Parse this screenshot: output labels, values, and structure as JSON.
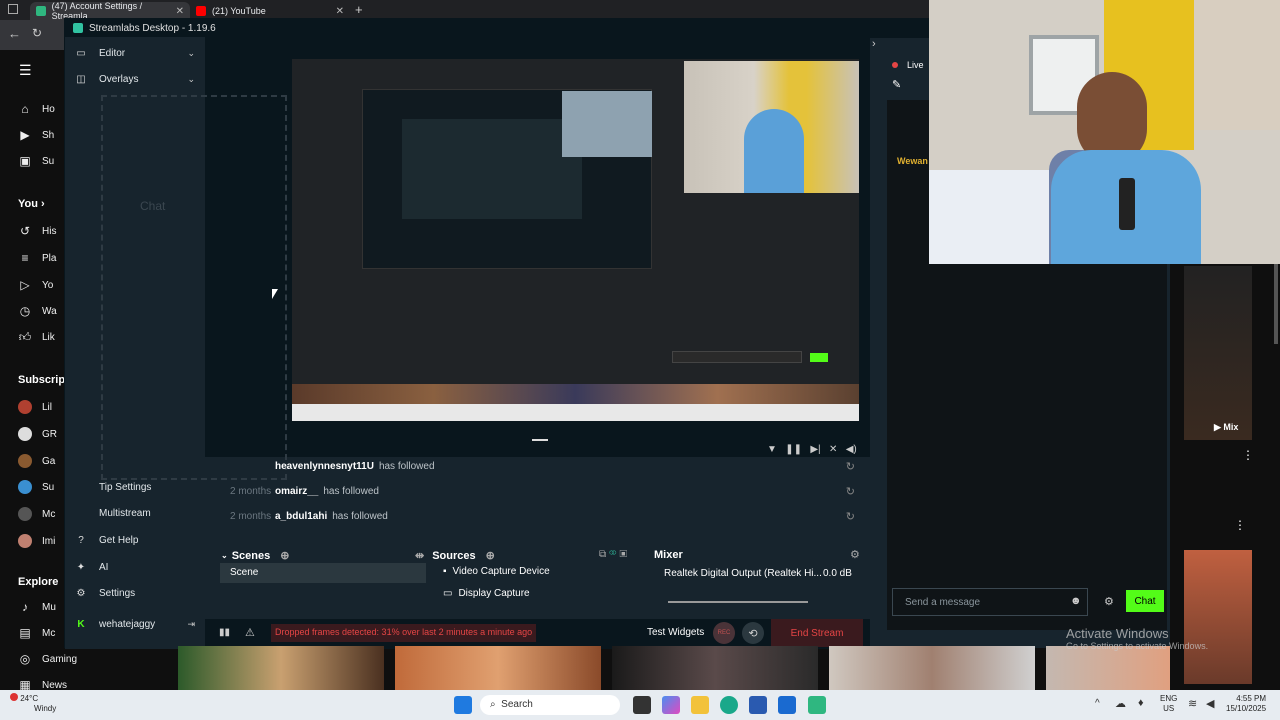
{
  "browser": {
    "tabs": [
      {
        "label": "(47) Account Settings / Streamla",
        "color": "#2fb780"
      },
      {
        "label": "(21) YouTube",
        "color": "#ff0000"
      }
    ]
  },
  "youtube": {
    "nav": [
      {
        "label": "Ho",
        "icon": "home-icon"
      },
      {
        "label": "Sh",
        "icon": "shorts-icon"
      },
      {
        "label": "Su",
        "icon": "subscriptions-icon"
      }
    ],
    "you_heading": "You",
    "you_items": [
      {
        "label": "His",
        "icon": "history-icon"
      },
      {
        "label": "Pla",
        "icon": "playlists-icon"
      },
      {
        "label": "Yo",
        "icon": "your-videos-icon"
      },
      {
        "label": "Wa",
        "icon": "watch-later-icon"
      },
      {
        "label": "Lik",
        "icon": "liked-icon"
      }
    ],
    "subscriptions_heading": "Subscript",
    "subscriptions": [
      {
        "label": "Lil",
        "color": "#b04030"
      },
      {
        "label": "GR",
        "color": "#dddddd"
      },
      {
        "label": "Ga",
        "color": "#8a5a30"
      },
      {
        "label": "Su",
        "color": "#3a8fd0"
      },
      {
        "label": "Mc",
        "color": "#555555"
      },
      {
        "label": "Imi",
        "color": "#c08070"
      }
    ],
    "explore_heading": "Explore",
    "explore": [
      {
        "label": "Mu",
        "icon": "music-icon"
      },
      {
        "label": "Mc",
        "icon": "movies-icon"
      },
      {
        "label": "Gaming",
        "icon": "gaming-icon"
      },
      {
        "label": "News",
        "icon": "news-icon"
      }
    ]
  },
  "streamlabs": {
    "title": "Streamlabs Desktop - 1.19.6",
    "nav": {
      "editor": "Editor",
      "overlays": "Overlays",
      "tip_settings": "Tip Settings",
      "multistream": "Multistream",
      "get_help": "Get Help",
      "ai": "AI",
      "settings": "Settings",
      "username": "wehatejaggy"
    },
    "chat_placeholder": "Chat",
    "feed": [
      {
        "time": "",
        "user": "heavenlynnesnyt11U",
        "action": "has followed"
      },
      {
        "time": "2 months",
        "user": "omairz__",
        "action": "has followed"
      },
      {
        "time": "2 months",
        "user": "a_bdul1ahi",
        "action": "has followed"
      }
    ],
    "scenes": {
      "heading": "Scenes",
      "items": [
        "Scene"
      ]
    },
    "sources": {
      "heading": "Sources",
      "items": [
        "Video Capture Device",
        "Display Capture"
      ]
    },
    "mixer": {
      "heading": "Mixer",
      "device": "Realtek Digital Output (Realtek Hi...",
      "level": "0.0 dB"
    },
    "status": {
      "warning": "Dropped frames detected: 31% over last 2 minutes a minute ago",
      "test_widgets": "Test Widgets",
      "rec": "REC",
      "end_stream": "End Stream"
    }
  },
  "chat_panel": {
    "live_label": "Live",
    "username_preview": "Wewan",
    "input_placeholder": "Send a message",
    "chat_button": "Chat"
  },
  "yt_right": {
    "mix_label": "Mix"
  },
  "watermark": {
    "line1": "Activate Windows",
    "line2": "Go to Settings to activate Windows."
  },
  "taskbar": {
    "weather_temp": "24°C",
    "weather_desc": "Windy",
    "search": "Search",
    "lang1": "ENG",
    "lang2": "US",
    "time": "4:55 PM",
    "date": "15/10/2025"
  },
  "colors": {
    "accent_green": "#31c3a2",
    "chat_button": "#53fc18",
    "end_stream": "#e54545",
    "warning": "#e54545"
  }
}
